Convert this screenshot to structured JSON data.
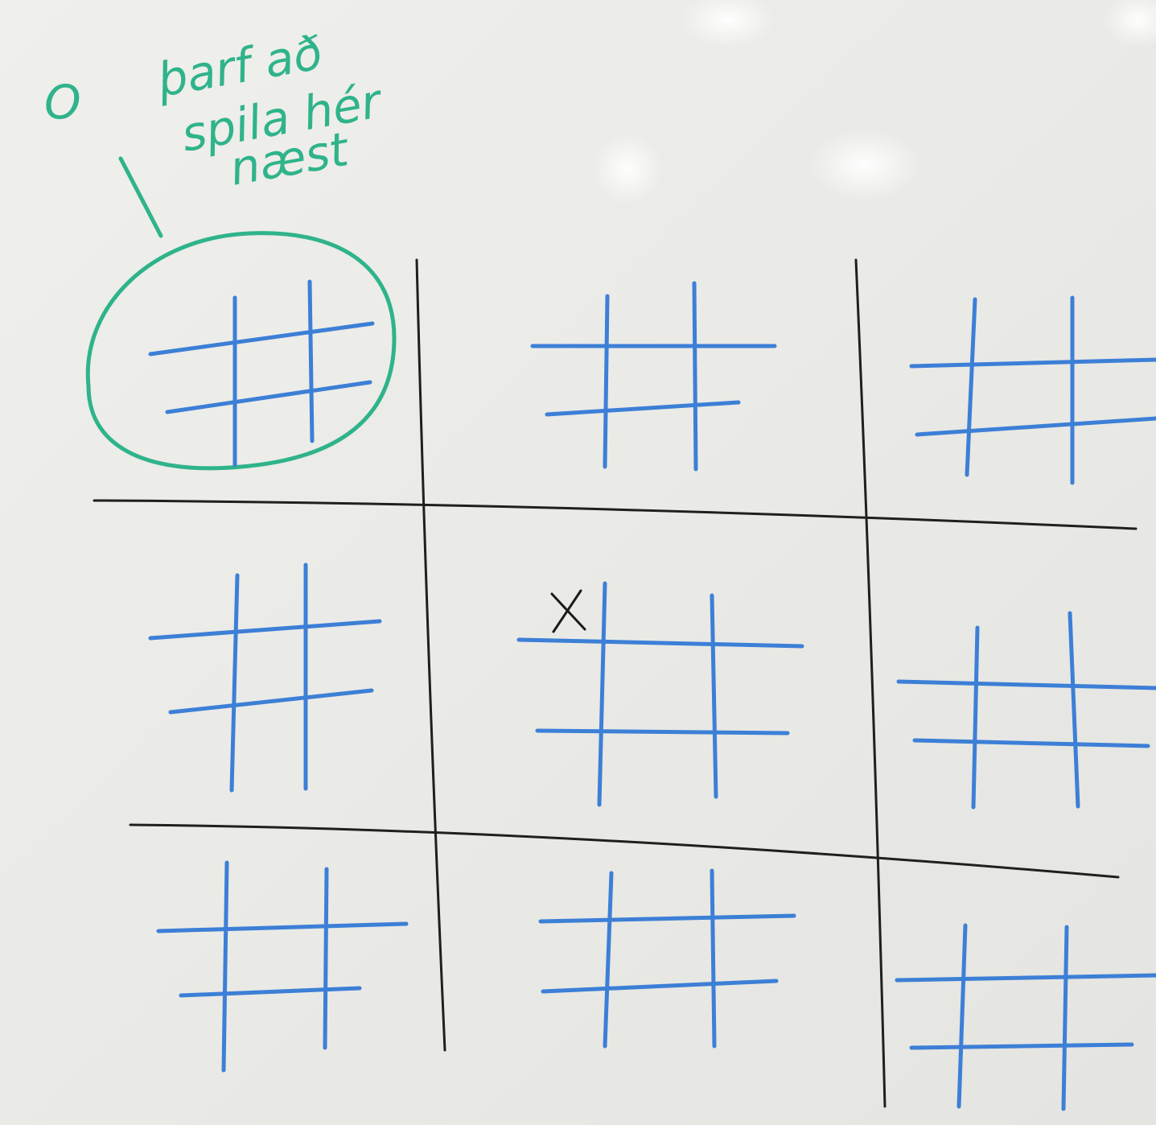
{
  "scene": {
    "description_type": "whiteboard-photo",
    "game": "ultimate tic-tac-toe",
    "colors": {
      "board": "#ecece9",
      "outer_grid": "#1f1f1f",
      "inner_grid": "#3c7fd6",
      "annotation": "#2fb38a",
      "x_mark": "#1a1a1a"
    }
  },
  "annotation": {
    "o_symbol": "O",
    "line1": "þarf að",
    "line2": "spila hér",
    "line3": "næst"
  },
  "game_state": {
    "marks": [
      {
        "symbol": "X",
        "big_cell": "center",
        "small_cell": "top-left"
      }
    ],
    "next_player": "O",
    "next_board": "top-left"
  }
}
